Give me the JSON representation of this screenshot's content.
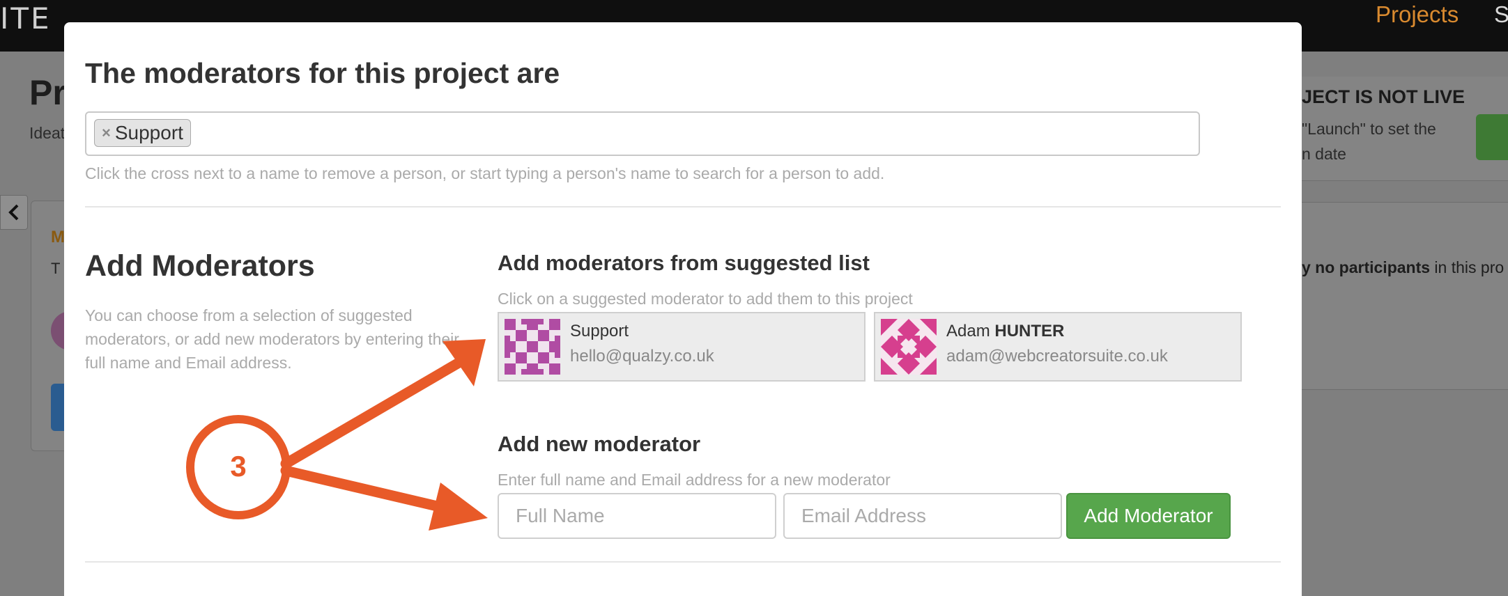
{
  "app": {
    "brand": "ITE",
    "nav_projects": "Projects",
    "nav_partial": "S",
    "page_title": "Pr",
    "page_sub": "Ideat",
    "left_card_letter": "M",
    "left_card_text": "T",
    "live_heading": "JECT IS NOT LIVE",
    "live_line1": "\"Launch\" to set the",
    "live_line2": "n date",
    "participants_strong": "y no participants",
    "participants_rest": " in this pro"
  },
  "modal": {
    "title": "The moderators for this project are",
    "current_moderators": [
      {
        "remove": "×",
        "name": "Support"
      }
    ],
    "help_text": "Click the cross next to a name to remove a person, or start typing a person's name to search for a person to add.",
    "add_heading": "Add Moderators",
    "add_description": "You can choose from a selection of suggested moderators, or add new moderators by entering their full name and Email address.",
    "suggested": {
      "heading": "Add moderators from suggested list",
      "help": "Click on a suggested moderator to add them to this project",
      "items": [
        {
          "first": "Support",
          "last": "",
          "email": "hello@qualzy.co.uk",
          "avatar_color": "#b04ca3"
        },
        {
          "first": "Adam",
          "last": "HUNTER",
          "email": "adam@webcreatorsuite.co.uk",
          "avatar_color": "#d63f8e"
        }
      ]
    },
    "new_moderator": {
      "heading": "Add new moderator",
      "help": "Enter full name and Email address for a new moderator",
      "full_name_placeholder": "Full Name",
      "email_placeholder": "Email Address",
      "button_label": "Add Moderator"
    }
  },
  "annotation": {
    "step_number": "3",
    "color": "#e85a28"
  }
}
